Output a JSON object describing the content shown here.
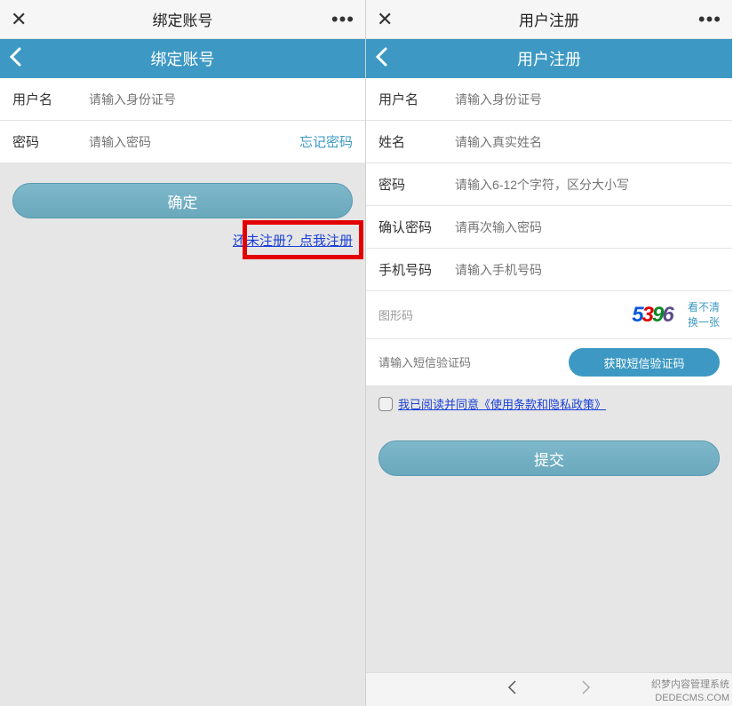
{
  "left": {
    "titlebar_title": "绑定账号",
    "subheader_title": "绑定账号",
    "fields": {
      "username_label": "用户名",
      "username_placeholder": "请输入身份证号",
      "password_label": "密码",
      "password_placeholder": "请输入密码",
      "forgot": "忘记密码"
    },
    "confirm_btn": "确定",
    "register_link": "还未注册？点我注册"
  },
  "right": {
    "titlebar_title": "用户注册",
    "subheader_title": "用户注册",
    "fields": {
      "username_label": "用户名",
      "username_placeholder": "请输入身份证号",
      "name_label": "姓名",
      "name_placeholder": "请输入真实姓名",
      "password_label": "密码",
      "password_placeholder": "请输入6-12个字符，区分大小写",
      "confirm_pw_label": "确认密码",
      "confirm_pw_placeholder": "请再次输入密码",
      "phone_label": "手机号码",
      "phone_placeholder": "请输入手机号码",
      "captcha_label": "图形码",
      "captcha_refresh1": "看不清",
      "captcha_refresh2": "换一张",
      "sms_placeholder": "请输入短信验证码",
      "sms_btn": "获取短信验证码"
    },
    "captcha_value": "5396",
    "agree_text": "我已阅读并同意《使用条款和隐私政策》",
    "submit_btn": "提交"
  },
  "footer": {
    "line1": "织梦内容管理系统",
    "line2": "DEDECMS.COM"
  }
}
